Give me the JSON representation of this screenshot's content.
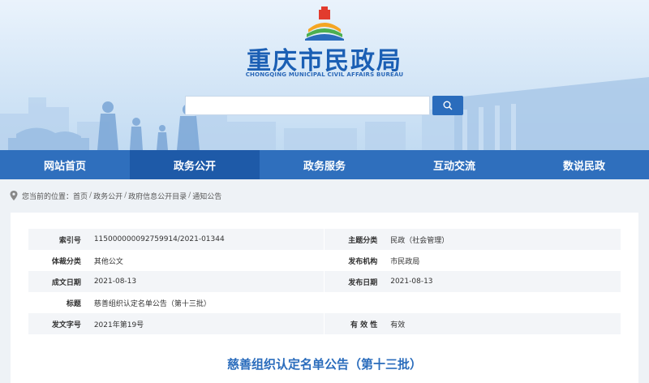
{
  "header": {
    "title": "重庆市民政局",
    "subtitle": "CHONGQING MUNICIPAL CIVIL AFFAIRS BUREAU",
    "watermark": "重庆市民政局",
    "watermark_en": "Civil Affairs Bureau",
    "search_placeholder": "",
    "accent_color": "#1b5fb4"
  },
  "nav": {
    "items": [
      {
        "label": "网站首页",
        "active": false
      },
      {
        "label": "政务公开",
        "active": true
      },
      {
        "label": "政务服务",
        "active": false
      },
      {
        "label": "互动交流",
        "active": false
      },
      {
        "label": "数说民政",
        "active": false
      }
    ],
    "bar_color": "#2f6fbd"
  },
  "breadcrumb": {
    "prefix": "您当前的位置：",
    "items": [
      "首页",
      "政务公开",
      "政府信息公开目录",
      "通知公告"
    ],
    "separator": "/"
  },
  "meta": {
    "rows": [
      {
        "k1": "索引号",
        "v1": "115000000092759914/2021-01344",
        "k2": "主题分类",
        "v2": "民政（社会管理）"
      },
      {
        "k1": "体裁分类",
        "v1": "其他公文",
        "k2": "发布机构",
        "v2": "市民政局"
      },
      {
        "k1": "成文日期",
        "v1": "2021-08-13",
        "k2": "发布日期",
        "v2": "2021-08-13"
      },
      {
        "k1": "标题",
        "v1": "慈善组织认定名单公告（第十三批）",
        "k2": "",
        "v2": ""
      },
      {
        "k1": "发文字号",
        "v1": "2021年第19号",
        "k2": "有 效 性",
        "v2": "有效"
      }
    ]
  },
  "document": {
    "title": "慈善组织认定名单公告（第十三批）"
  }
}
